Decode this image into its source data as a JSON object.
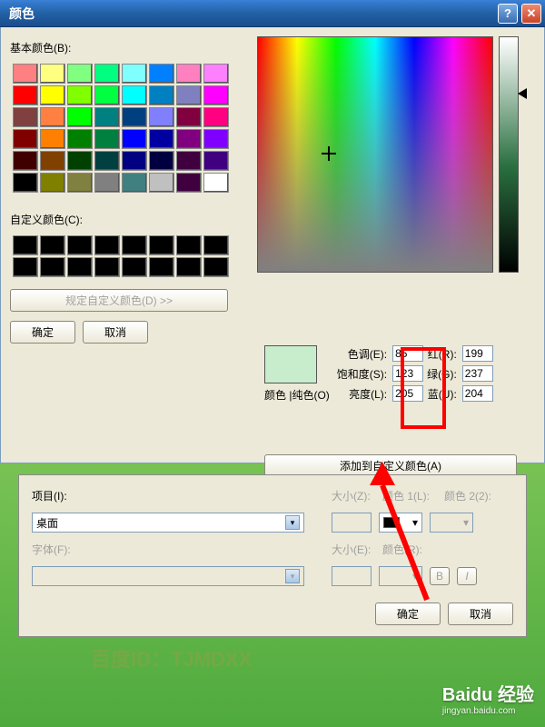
{
  "window": {
    "title": "颜色"
  },
  "labels": {
    "basic_colors": "基本颜色(B):",
    "custom_colors": "自定义颜色(C):",
    "define_custom": "规定自定义颜色(D) >>",
    "ok": "确定",
    "cancel": "取消",
    "hue": "色调(E):",
    "sat": "饱和度(S):",
    "lum": "亮度(L):",
    "red": "红(R):",
    "green": "绿(G):",
    "blue": "蓝(U):",
    "color_solid": "颜色 |纯色(O)",
    "add_custom": "添加到自定义颜色(A)"
  },
  "values": {
    "hue": "85",
    "sat": "123",
    "lum": "205",
    "red": "199",
    "green": "237",
    "blue": "204",
    "preview_color": "#c7edcc"
  },
  "basic_colors": [
    "#ff8080",
    "#ffff80",
    "#80ff80",
    "#00ff80",
    "#80ffff",
    "#0080ff",
    "#ff80c0",
    "#ff80ff",
    "#ff0000",
    "#ffff00",
    "#80ff00",
    "#00ff40",
    "#00ffff",
    "#0080c0",
    "#8080c0",
    "#ff00ff",
    "#804040",
    "#ff8040",
    "#00ff00",
    "#008080",
    "#004080",
    "#8080ff",
    "#800040",
    "#ff0080",
    "#800000",
    "#ff8000",
    "#008000",
    "#008040",
    "#0000ff",
    "#0000a0",
    "#800080",
    "#8000ff",
    "#400000",
    "#804000",
    "#004000",
    "#004040",
    "#000080",
    "#000040",
    "#400040",
    "#400080",
    "#000000",
    "#808000",
    "#808040",
    "#808080",
    "#408080",
    "#c0c0c0",
    "#400040",
    "#ffffff"
  ],
  "custom_swatches": [
    "#000000",
    "#000000",
    "#000000",
    "#000000",
    "#000000",
    "#000000",
    "#000000",
    "#000000",
    "#000000",
    "#000000",
    "#000000",
    "#000000",
    "#000000",
    "#000000",
    "#000000",
    "#000000"
  ],
  "sub_dialog": {
    "item_label": "项目(I):",
    "item_value": "桌面",
    "font_label": "字体(F):",
    "size_label": "大小(Z):",
    "color1_label": "颜色 1(L):",
    "color2_label": "颜色 2(2):",
    "size2_label": "大小(E):",
    "color_r_label": "颜色(R):",
    "ok": "确定",
    "cancel": "取消"
  },
  "watermark": {
    "text": "百度ID：TJMDXX",
    "brand": "Baidu 经验",
    "url": "jingyan.baidu.com"
  }
}
